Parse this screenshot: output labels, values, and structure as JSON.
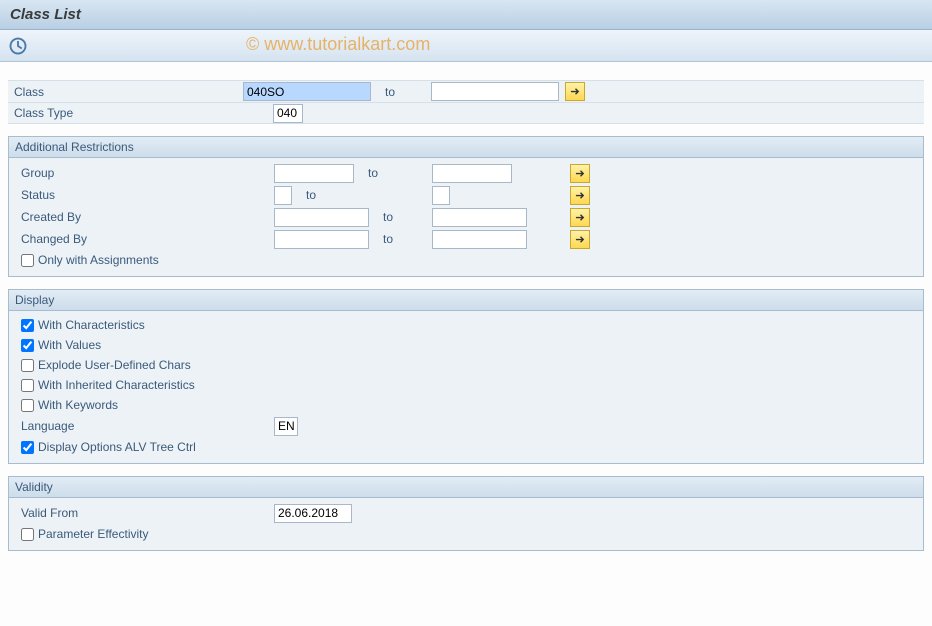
{
  "title": "Class List",
  "watermark": "© www.tutorialkart.com",
  "top": {
    "class_label": "Class",
    "class_from": "040SO",
    "class_to": "",
    "to_label": "to",
    "class_type_label": "Class Type",
    "class_type": "040"
  },
  "restrictions": {
    "header": "Additional Restrictions",
    "group_label": "Group",
    "group_from": "",
    "group_to": "",
    "status_label": "Status",
    "status_from": "",
    "status_to": "",
    "created_label": "Created By",
    "created_from": "",
    "created_to": "",
    "changed_label": "Changed By",
    "changed_from": "",
    "changed_to": "",
    "only_assign_label": "Only with Assignments",
    "to_label": "to"
  },
  "display": {
    "header": "Display",
    "with_char_label": "With Characteristics",
    "with_values_label": "With Values",
    "explode_label": "Explode User-Defined Chars",
    "inherited_label": "With Inherited Characteristics",
    "keywords_label": "With Keywords",
    "language_label": "Language",
    "language_value": "EN",
    "alv_label": "Display Options ALV Tree Ctrl"
  },
  "validity": {
    "header": "Validity",
    "valid_from_label": "Valid From",
    "valid_from_value": "26.06.2018",
    "param_eff_label": "Parameter Effectivity"
  }
}
